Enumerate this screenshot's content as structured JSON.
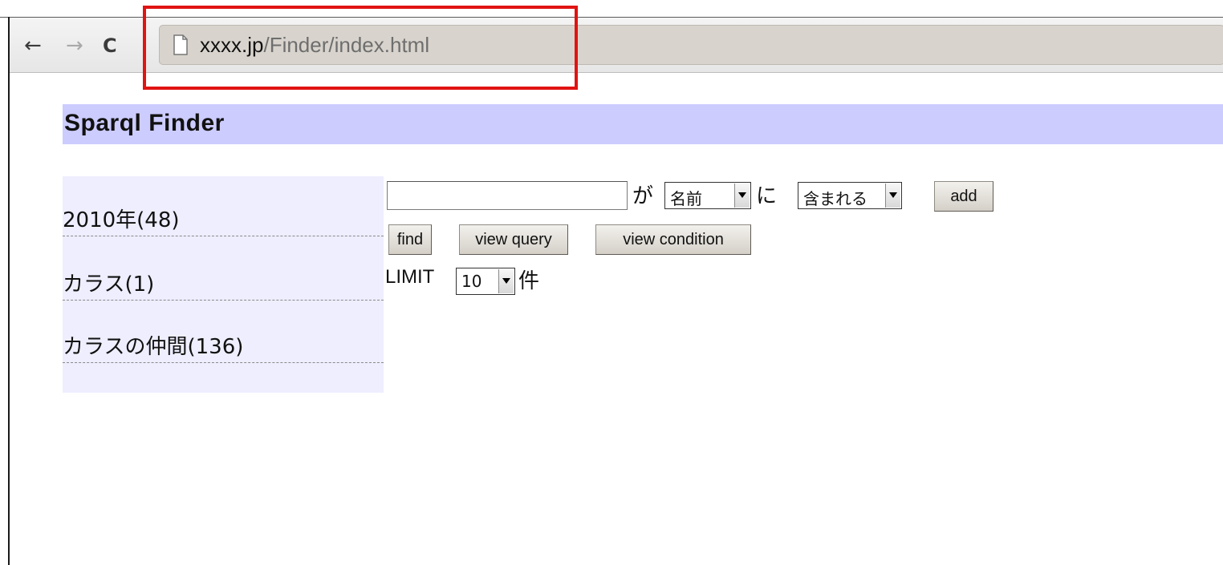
{
  "browser": {
    "back_glyph": "←",
    "forward_glyph": "→",
    "reload_glyph": "C",
    "url_host": "xxxx.jp",
    "url_path": "/Finder/index.html",
    "highlight_color": "#e11313"
  },
  "page": {
    "title": "Sparql Finder",
    "title_bg": "#ccccff"
  },
  "facets": [
    {
      "label": "2010年(48)"
    },
    {
      "label": "カラス(1)"
    },
    {
      "label": "カラスの仲間(136)"
    }
  ],
  "form": {
    "search_value": "",
    "ga_label": "が",
    "property_selected": "名前",
    "ni_label": "に",
    "match_selected": "含まれる",
    "add_label": "add",
    "find_label": "find",
    "view_query_label": "view query",
    "view_condition_label": "view condition",
    "limit_label": "LIMIT",
    "limit_selected": "10",
    "limit_unit": "件"
  }
}
